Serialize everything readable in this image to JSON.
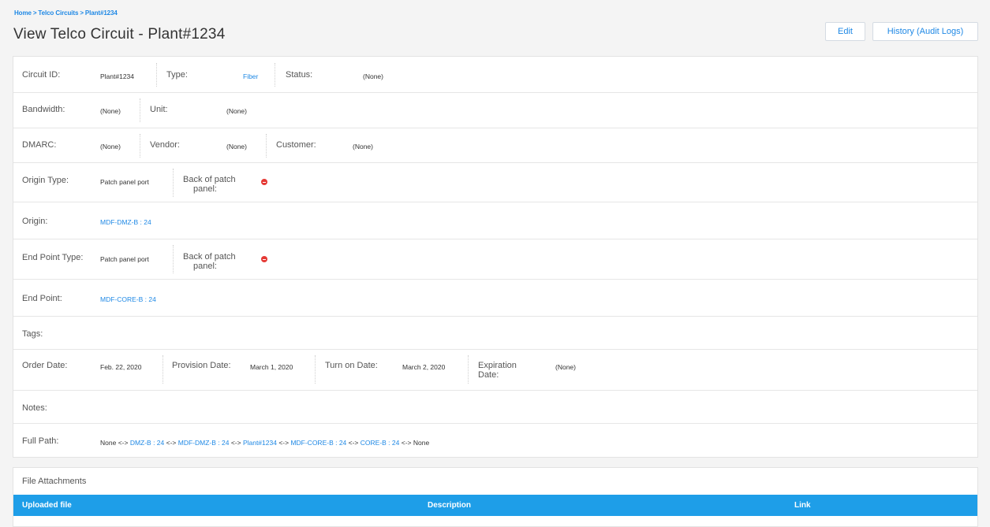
{
  "breadcrumb": {
    "home": "Home",
    "section": "Telco Circuits",
    "current": "Plant#1234",
    "separator": ">"
  },
  "title": "View Telco Circuit - Plant#1234",
  "buttons": {
    "edit": "Edit",
    "history": "History (Audit Logs)"
  },
  "fields": {
    "circuit_id": {
      "label": "Circuit ID:",
      "value": "Plant#1234"
    },
    "type": {
      "label": "Type:",
      "value": "Fiber"
    },
    "status": {
      "label": "Status:",
      "value": "(None)"
    },
    "bandwidth": {
      "label": "Bandwidth:",
      "value": "(None)"
    },
    "unit": {
      "label": "Unit:",
      "value": "(None)"
    },
    "dmarc": {
      "label": "DMARC:",
      "value": "(None)"
    },
    "vendor": {
      "label": "Vendor:",
      "value": "(None)"
    },
    "customer": {
      "label": "Customer:",
      "value": "(None)"
    },
    "origin_type": {
      "label": "Origin Type:",
      "value": "Patch panel port"
    },
    "origin_back": {
      "label_line1": "Back of patch",
      "label_line2": "panel:"
    },
    "origin": {
      "label": "Origin:",
      "value": "MDF-DMZ-B : 24"
    },
    "end_point_type": {
      "label": "End Point Type:",
      "value": "Patch panel port"
    },
    "end_back": {
      "label_line1": "Back of patch",
      "label_line2": "panel:"
    },
    "end_point": {
      "label": "End Point:",
      "value": "MDF-CORE-B : 24"
    },
    "tags": {
      "label": "Tags:"
    },
    "order_date": {
      "label": "Order Date:",
      "value": "Feb. 22, 2020"
    },
    "provision_date": {
      "label": "Provision Date:",
      "value": "March 1, 2020"
    },
    "turn_on_date": {
      "label": "Turn on Date:",
      "value": "March 2, 2020"
    },
    "expiration_date": {
      "label_line1": "Expiration",
      "label_line2": "Date:",
      "value": "(None)"
    },
    "notes": {
      "label": "Notes:"
    },
    "full_path": {
      "label": "Full Path:",
      "parts": {
        "p0": "None",
        "s1": " <-> ",
        "l1": "DMZ-B : 24",
        "s2": " <-> ",
        "l2": "MDF-DMZ-B : 24",
        "s3": " <-> ",
        "l3": "Plant#1234",
        "s4": " <-> ",
        "l4": "MDF-CORE-B : 24",
        "s5": " <-> ",
        "l5": "CORE-B : 24",
        "s6": " <-> ",
        "p7": "None"
      }
    }
  },
  "attachments": {
    "title": "File Attachments",
    "columns": [
      "Uploaded file",
      "Description",
      "Link"
    ]
  },
  "colors": {
    "accent": "#1e88e5",
    "table_header": "#1e9ee8",
    "error_icon": "#e53935"
  },
  "icons": {
    "back_of_patch_panel": "stop-icon"
  }
}
